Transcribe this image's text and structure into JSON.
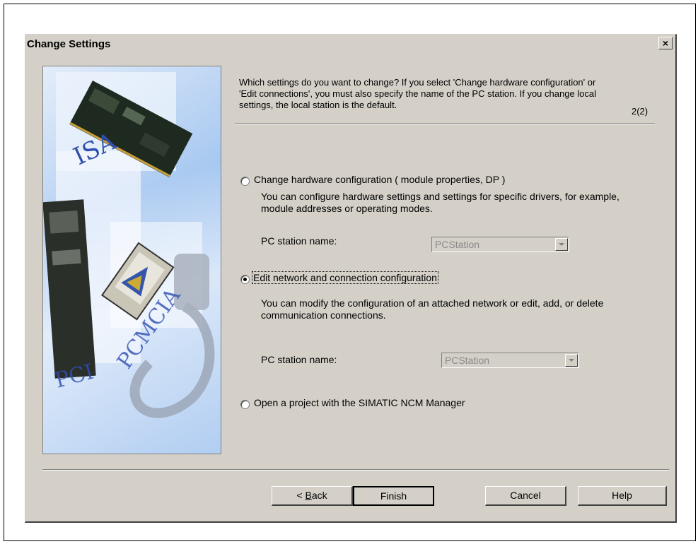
{
  "window": {
    "title": "Change Settings",
    "close_symbol": "×"
  },
  "header": {
    "text": "Which settings do you want to change? If you select 'Change hardware configuration' or 'Edit connections', you must also specify the name of the PC station. If you change local settings, the local station is the default.",
    "page": "2(2)"
  },
  "graphic": {
    "labels": [
      "ISA",
      "PCMCIA",
      "PCI"
    ]
  },
  "options": [
    {
      "label": "Change hardware configuration ( module properties, DP )",
      "selected": false,
      "description": "You can configure hardware settings and settings for specific drivers, for example, module addresses or operating modes.",
      "station_label": "PC station name:",
      "station_value": "PCStation"
    },
    {
      "label": "Edit network and connection configuration",
      "selected": true,
      "description": "You can modify the configuration of an attached network or edit, add, or delete communication connections.",
      "station_label": "PC station name:",
      "station_value": "PCStation"
    },
    {
      "label": "Open a project with the SIMATIC NCM Manager",
      "selected": false
    }
  ],
  "buttons": {
    "back_prefix": "< ",
    "back_mnemonic": "B",
    "back_rest": "ack",
    "finish": "Finish",
    "cancel": "Cancel",
    "help": "Help"
  },
  "colors": {
    "dialog_bg": "#d4d0c8",
    "disabled_text": "#8a8a8a"
  }
}
